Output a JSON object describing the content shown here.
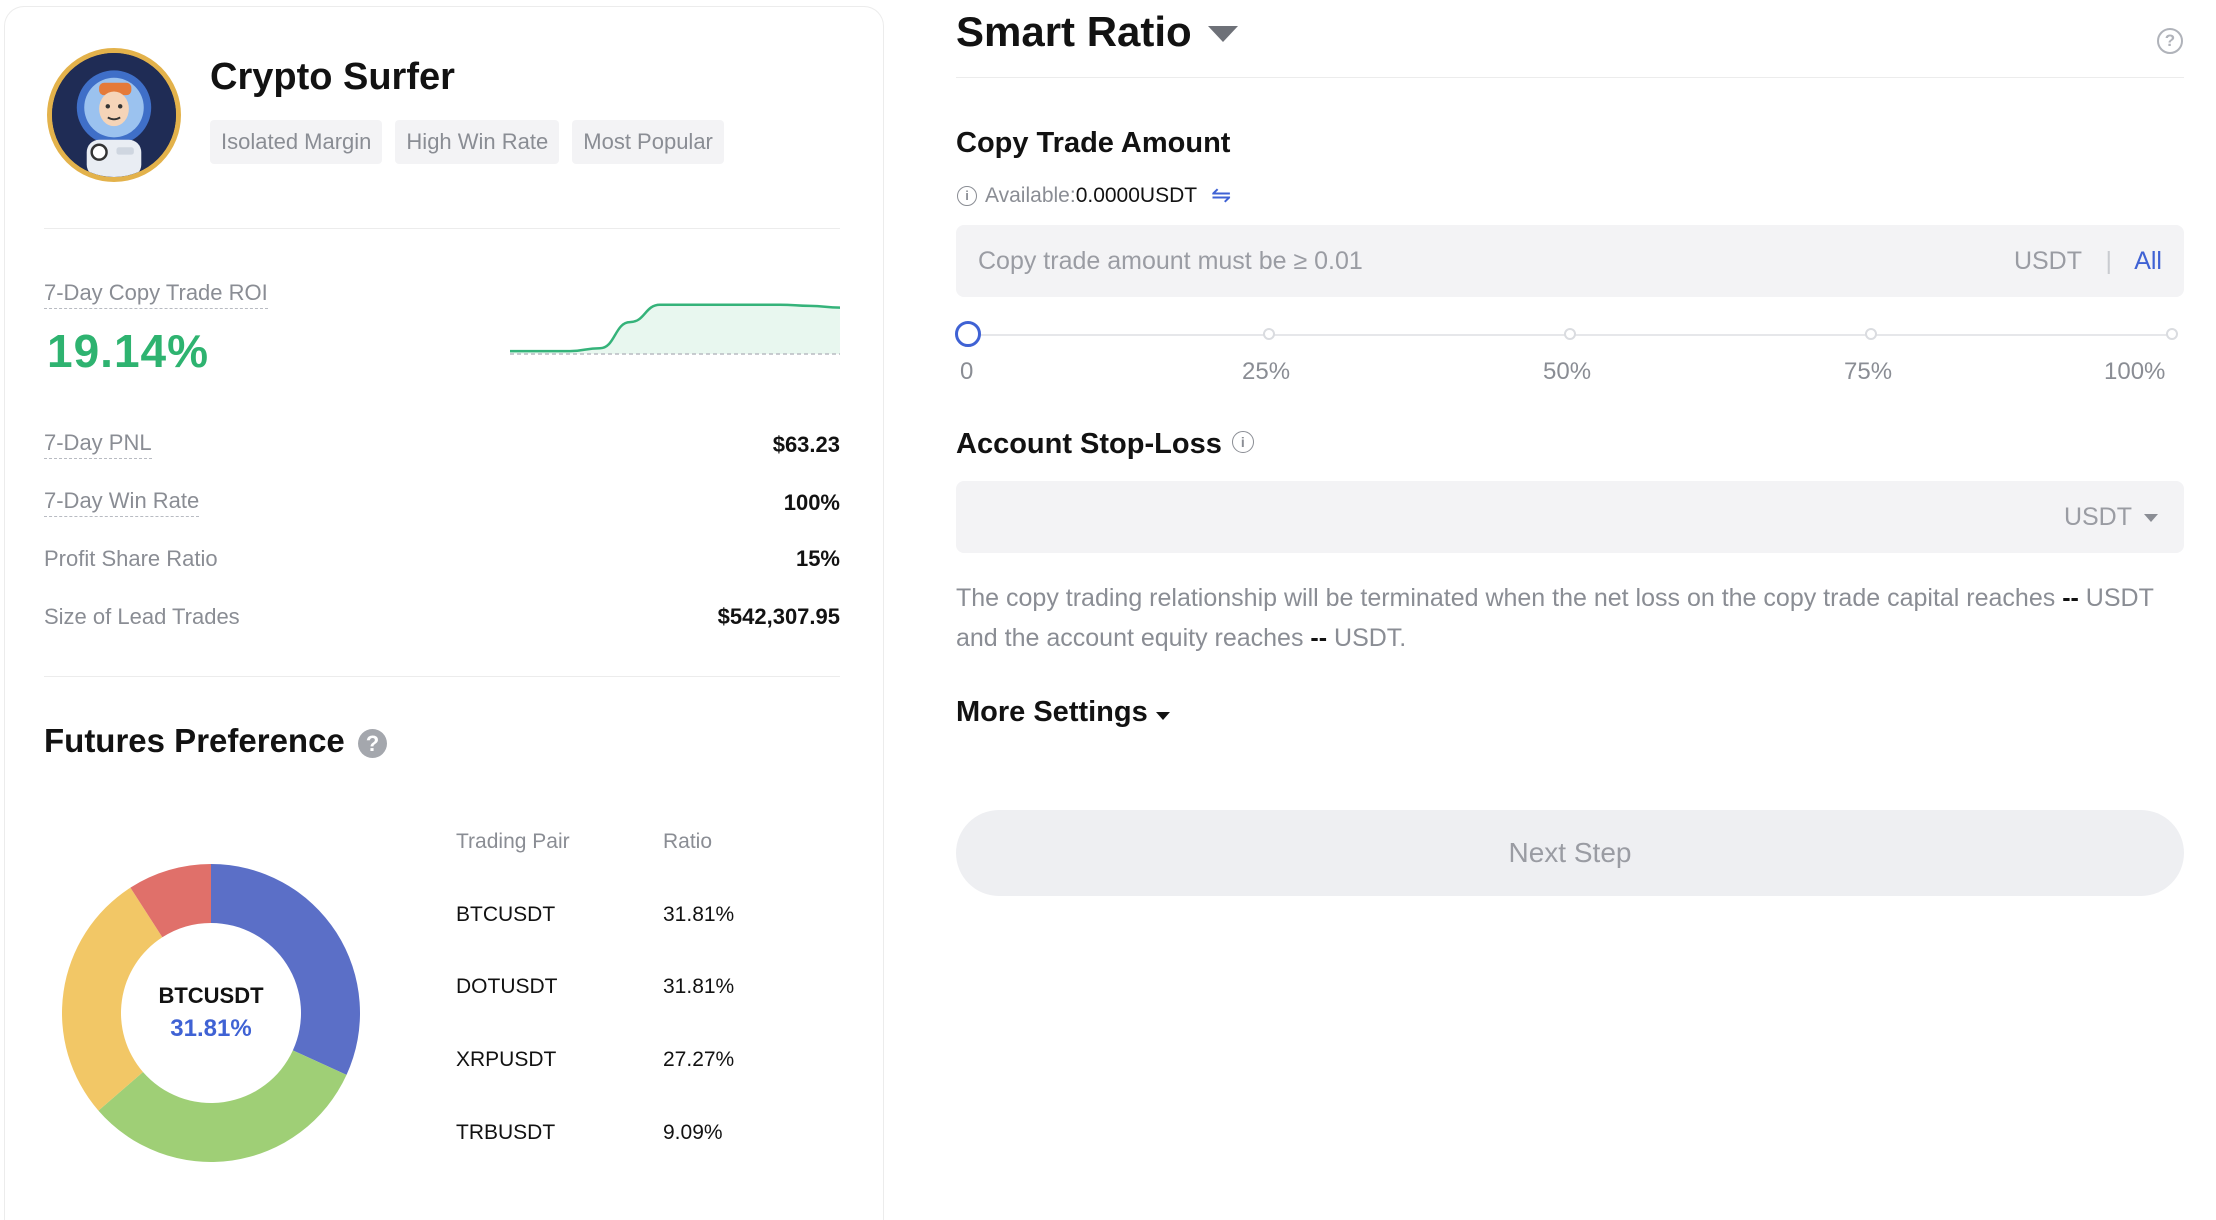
{
  "trader": {
    "name": "Crypto Surfer",
    "tags": [
      "Isolated Margin",
      "High Win Rate",
      "Most Popular"
    ]
  },
  "roi": {
    "label": "7-Day Copy Trade ROI",
    "value": "19.14%"
  },
  "stats": [
    {
      "label": "7-Day PNL",
      "value": "$63.23"
    },
    {
      "label": "7-Day Win Rate",
      "value": "100%"
    },
    {
      "label": "Profit Share Ratio",
      "value": "15%"
    },
    {
      "label": "Size of Lead Trades",
      "value": "$542,307.95"
    }
  ],
  "futures_preference": {
    "title": "Futures Preference",
    "help_icon": "?",
    "center_pair": "BTCUSDT",
    "center_ratio": "31.81%",
    "columns": [
      "Trading Pair",
      "Ratio"
    ],
    "rows": [
      {
        "pair": "BTCUSDT",
        "ratio": "31.81%"
      },
      {
        "pair": "DOTUSDT",
        "ratio": "31.81%"
      },
      {
        "pair": "XRPUSDT",
        "ratio": "27.27%"
      },
      {
        "pair": "TRBUSDT",
        "ratio": "9.09%"
      }
    ]
  },
  "chart_data": {
    "type": "pie",
    "categories": [
      "BTCUSDT",
      "DOTUSDT",
      "XRPUSDT",
      "TRBUSDT"
    ],
    "values": [
      31.81,
      31.81,
      27.27,
      9.09
    ],
    "colors": [
      "#5b6fc7",
      "#9fcf76",
      "#f2c766",
      "#e0706a"
    ],
    "donut": true
  },
  "sparkline": {
    "line_color": "#35b37a",
    "fill_color": "#e8f7ef",
    "points": [
      0.05,
      0.05,
      0.05,
      0.1,
      0.55,
      0.85,
      0.85,
      0.85,
      0.85,
      0.85,
      0.83,
      0.8
    ]
  },
  "right": {
    "title": "Smart Ratio",
    "copy_amount": {
      "label": "Copy Trade Amount",
      "available_label": "Available:",
      "available_value": "0.0000USDT",
      "placeholder": "Copy trade amount must be ≥ 0.01",
      "unit": "USDT",
      "separator": "|",
      "all_label": "All",
      "slider_value": 0,
      "slider_labels": [
        "0",
        "25%",
        "50%",
        "75%",
        "100%"
      ]
    },
    "stop_loss": {
      "label": "Account Stop-Loss",
      "unit": "USDT",
      "desc_part1": "The copy trading relationship will be terminated when the net loss on the copy trade capital reaches ",
      "desc_val1": "--",
      "desc_part2": " USDT and the account equity reaches ",
      "desc_val2": "--",
      "desc_part3": " USDT."
    },
    "more_settings": "More Settings",
    "next_button": "Next Step"
  }
}
